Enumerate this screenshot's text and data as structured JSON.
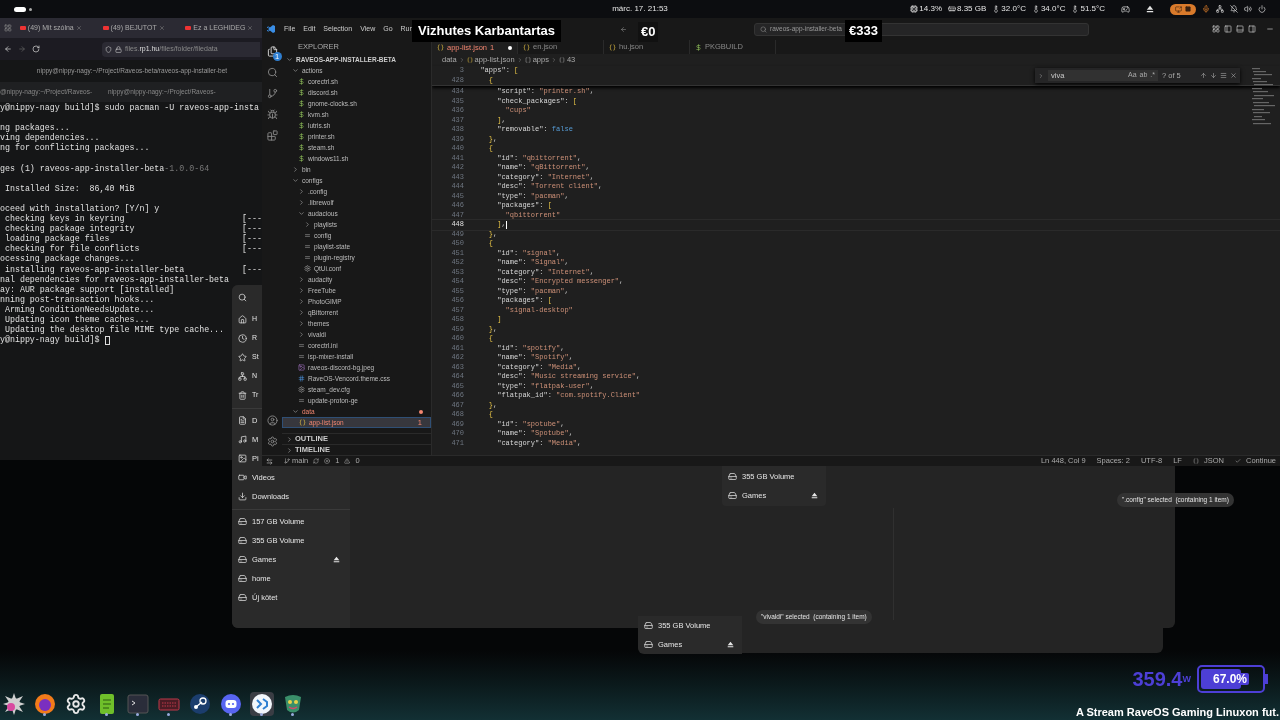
{
  "top_bar": {
    "date_time": "márc. 17. 21:53",
    "stats": [
      {
        "kind": "cpu",
        "text": "14.3%"
      },
      {
        "kind": "memory",
        "text": "8.35 GB"
      },
      {
        "kind": "temp",
        "text": "32.0°C"
      },
      {
        "kind": "temp",
        "text": "34.0°C"
      },
      {
        "kind": "temp",
        "text": "51.5°C"
      }
    ]
  },
  "browser": {
    "tabs": [
      "(49) Mit szólna",
      "(49) BEJUTOT",
      "Ez a LEGHIDEG"
    ],
    "url": "files.**rp1.hu**/files/folder/filedata"
  },
  "terminal": {
    "title": "nippy@nippy-nagy:~/Project/Raveos-beta/raveos-app-installer-bet",
    "tabs": [
      "@nippy-nagy:~/Project/Raveos-",
      "nippy@nippy-nagy:~/Project/Raveos-"
    ],
    "cursor": true,
    "lines": [
      {
        "kind": "text",
        "text": "y@nippy-nagy build]$ sudo pacman -U raveos-app-insta"
      },
      {
        "kind": "blank"
      },
      {
        "kind": "text",
        "text": "ng packages..."
      },
      {
        "kind": "text",
        "text": "ving dependencies..."
      },
      {
        "kind": "text",
        "text": "ng for conflicting packages..."
      },
      {
        "kind": "blank"
      },
      {
        "kind": "text",
        "text": "ges (1) raveos-app-installer-beta",
        "suffix": "-1.0.0-64"
      },
      {
        "kind": "blank"
      },
      {
        "kind": "text",
        "text": " Installed Size:  86,40 MiB"
      },
      {
        "kind": "blank"
      },
      {
        "kind": "text",
        "text": "oceed with installation? [Y/n] y"
      },
      {
        "kind": "text",
        "text": " checking keys in keyring",
        "progress": "[---"
      },
      {
        "kind": "text",
        "text": " checking package integrity",
        "progress": "[---"
      },
      {
        "kind": "text",
        "text": " loading package files",
        "progress": "[---"
      },
      {
        "kind": "text",
        "text": " checking for file conflicts",
        "progress": "[---"
      },
      {
        "kind": "text",
        "text": "ocessing package changes..."
      },
      {
        "kind": "text",
        "text": " installing raveos-app-installer-beta",
        "progress": "[---"
      },
      {
        "kind": "text",
        "text": "nal dependencies for raveos-app-installer-beta"
      },
      {
        "kind": "text",
        "text": "ay: AUR package support [installed]"
      },
      {
        "kind": "text",
        "text": "nning post-transaction hooks..."
      },
      {
        "kind": "text",
        "text": " Arming ConditionNeedsUpdate..."
      },
      {
        "kind": "text",
        "text": " Updating icon theme caches..."
      },
      {
        "kind": "text",
        "text": " Updating the desktop file MIME type cache..."
      },
      {
        "kind": "text",
        "text": "y@nippy-nagy build]$ "
      }
    ]
  },
  "file_manager": {
    "places": [
      {
        "label": "H",
        "kind": "home"
      },
      {
        "label": "R",
        "kind": "recent"
      },
      {
        "label": "St",
        "kind": "starred"
      },
      {
        "label": "N",
        "kind": "network"
      },
      {
        "label": "Tr",
        "kind": "trash"
      }
    ],
    "folders": [
      {
        "label": "D",
        "kind": "documents"
      },
      {
        "label": "M",
        "kind": "music"
      },
      {
        "label": "Pi",
        "kind": "pictures"
      },
      {
        "label": "Videos",
        "kind": "videos"
      },
      {
        "label": "Downloads",
        "kind": "downloads"
      }
    ],
    "volumes": [
      {
        "label": "157 GB Volume",
        "eject": false
      },
      {
        "label": "355 GB Volume",
        "eject": false
      },
      {
        "label": "Games",
        "eject": true
      },
      {
        "label": "home",
        "eject": false
      },
      {
        "label": "Új kötet",
        "eject": false
      }
    ],
    "popups": [
      {
        "items": [
          {
            "label": "355 GB Volume",
            "eject": false
          },
          {
            "label": "Games",
            "eject": true
          }
        ]
      },
      {
        "items": [
          {
            "label": "355 GB Volume",
            "eject": false
          },
          {
            "label": "Games",
            "eject": true
          }
        ]
      }
    ],
    "toasts": [
      "\".config\" selected  (containing 1 item)",
      "\"vivaldi\" selected  (containing 1 item)"
    ]
  },
  "editor": {
    "menu": [
      "File",
      "Edit",
      "Selection",
      "View",
      "Go",
      "Run"
    ],
    "search": "raveos-app-installer-beta",
    "explorer_badge": "1",
    "explorer": {
      "title": "EXPLORER",
      "tree": {
        "label": "RAVEOS-APP-INSTALLER-BETA",
        "kind": "folder",
        "expanded": true,
        "selected": false,
        "error": false,
        "children": [
          {
            "label": "actions",
            "kind": "folder",
            "expanded": true,
            "selected": false,
            "error": false,
            "children": [
              {
                "label": "corectrl.sh",
                "kind": "sh",
                "selected": false,
                "error": false
              },
              {
                "label": "discord.sh",
                "kind": "sh",
                "selected": false,
                "error": false
              },
              {
                "label": "gnome-clocks.sh",
                "kind": "sh",
                "selected": false,
                "error": false
              },
              {
                "label": "kvm.sh",
                "kind": "sh",
                "selected": false,
                "error": false
              },
              {
                "label": "lutris.sh",
                "kind": "sh",
                "selected": false,
                "error": false
              },
              {
                "label": "printer.sh",
                "kind": "sh",
                "selected": false,
                "error": false
              },
              {
                "label": "steam.sh",
                "kind": "sh",
                "selected": false,
                "error": false
              },
              {
                "label": "windows11.sh",
                "kind": "sh",
                "selected": false,
                "error": false
              }
            ]
          },
          {
            "label": "bin",
            "kind": "folder",
            "expanded": false,
            "selected": false,
            "error": false
          },
          {
            "label": "configs",
            "kind": "folder",
            "expanded": true,
            "selected": false,
            "error": false,
            "children": [
              {
                "label": ".config",
                "kind": "folder",
                "expanded": false,
                "selected": false,
                "error": false
              },
              {
                "label": ".librewolf",
                "kind": "folder",
                "expanded": false,
                "selected": false,
                "error": false
              },
              {
                "label": "audacious",
                "kind": "folder",
                "expanded": true,
                "selected": false,
                "error": false,
                "children": [
                  {
                    "label": "playlists",
                    "kind": "folder",
                    "expanded": false,
                    "selected": false,
                    "error": false
                  },
                  {
                    "label": "config",
                    "kind": "text",
                    "selected": false,
                    "error": false
                  },
                  {
                    "label": "playlist-state",
                    "kind": "text",
                    "selected": false,
                    "error": false
                  },
                  {
                    "label": "plugin-registry",
                    "kind": "text",
                    "selected": false,
                    "error": false
                  },
                  {
                    "label": "QtUi.conf",
                    "kind": "settings",
                    "selected": false,
                    "error": false
                  }
                ]
              },
              {
                "label": "audacity",
                "kind": "folder",
                "expanded": false,
                "selected": false,
                "error": false
              },
              {
                "label": "FreeTube",
                "kind": "folder",
                "expanded": false,
                "selected": false,
                "error": false
              },
              {
                "label": "PhotoGIMP",
                "kind": "folder",
                "expanded": false,
                "selected": false,
                "error": false
              },
              {
                "label": "qBittorrent",
                "kind": "folder",
                "expanded": false,
                "selected": false,
                "error": false
              },
              {
                "label": "themes",
                "kind": "folder",
                "expanded": false,
                "selected": false,
                "error": false
              },
              {
                "label": "vivaldi",
                "kind": "folder",
                "expanded": false,
                "selected": false,
                "error": false
              },
              {
                "label": "corectrl.ini",
                "kind": "text",
                "selected": false,
                "error": false
              },
              {
                "label": "isp-mixer-install",
                "kind": "text",
                "selected": false,
                "error": false
              },
              {
                "label": "raveos-discord-bg.jpeg",
                "kind": "image",
                "selected": false,
                "error": false
              },
              {
                "label": "RaveOS-Vencord.theme.css",
                "kind": "css",
                "selected": false,
                "error": false
              },
              {
                "label": "steam_dev.cfg",
                "kind": "settings",
                "selected": false,
                "error": false
              },
              {
                "label": "update-proton-ge",
                "kind": "text",
                "selected": false,
                "error": false
              }
            ]
          },
          {
            "label": "data",
            "kind": "folder",
            "expanded": true,
            "selected": false,
            "error": true,
            "children": [
              {
                "label": "app-list.json",
                "kind": "json",
                "selected": true,
                "error": true,
                "problems": "1"
              }
            ]
          }
        ]
      },
      "sections": [
        {
          "label": "OUTLINE",
          "expanded": false
        },
        {
          "label": "TIMELINE",
          "expanded": false
        }
      ]
    },
    "tabs": [
      {
        "label": "app-list.json",
        "kind": "json",
        "problems": "1",
        "modified": true,
        "selected": true
      },
      {
        "label": "en.json",
        "kind": "json",
        "modified": false,
        "selected": false
      },
      {
        "label": "hu.json",
        "kind": "json",
        "modified": false,
        "selected": false
      },
      {
        "label": "PKGBUILD",
        "kind": "sh",
        "modified": false,
        "selected": false
      }
    ],
    "breadcrumb": [
      {
        "kind": "folder",
        "text": "data"
      },
      {
        "kind": "json",
        "text": "app-list.json"
      },
      {
        "kind": "array",
        "text": "apps"
      },
      {
        "kind": "object",
        "text": "43"
      }
    ],
    "sticky": [
      {
        "number": "3",
        "text": "  \"apps\": ["
      },
      {
        "number": "428",
        "text": "    {"
      }
    ],
    "lines": [
      {
        "number": "434",
        "text": "      \"script\": \"printer.sh\",",
        "current": false
      },
      {
        "number": "435",
        "text": "      \"check_packages\": [",
        "current": false
      },
      {
        "number": "436",
        "text": "        \"cups\"",
        "current": false
      },
      {
        "number": "437",
        "text": "      ],",
        "current": false
      },
      {
        "number": "438",
        "text": "      \"removable\": false",
        "current": false
      },
      {
        "number": "439",
        "text": "    },",
        "current": false
      },
      {
        "number": "440",
        "text": "    {",
        "current": false
      },
      {
        "number": "441",
        "text": "      \"id\": \"qbittorrent\",",
        "current": false
      },
      {
        "number": "442",
        "text": "      \"name\": \"qBittorrent\",",
        "current": false
      },
      {
        "number": "443",
        "text": "      \"category\": \"Internet\",",
        "current": false
      },
      {
        "number": "444",
        "text": "      \"desc\": \"Torrent client\",",
        "current": false
      },
      {
        "number": "445",
        "text": "      \"type\": \"pacman\",",
        "current": false
      },
      {
        "number": "446",
        "text": "      \"packages\": [",
        "current": false
      },
      {
        "number": "447",
        "text": "        \"qbittorrent\"",
        "current": false
      },
      {
        "number": "448",
        "text": "      ],",
        "current": true
      },
      {
        "number": "449",
        "text": "    },",
        "current": false
      },
      {
        "number": "450",
        "text": "    {",
        "current": false
      },
      {
        "number": "451",
        "text": "      \"id\": \"signal\",",
        "current": false
      },
      {
        "number": "452",
        "text": "      \"name\": \"Signal\",",
        "current": false
      },
      {
        "number": "453",
        "text": "      \"category\": \"Internet\",",
        "current": false
      },
      {
        "number": "454",
        "text": "      \"desc\": \"Encrypted messenger\",",
        "current": false
      },
      {
        "number": "455",
        "text": "      \"type\": \"pacman\",",
        "current": false
      },
      {
        "number": "456",
        "text": "      \"packages\": [",
        "current": false
      },
      {
        "number": "457",
        "text": "        \"signal-desktop\"",
        "current": false
      },
      {
        "number": "458",
        "text": "      ]",
        "current": false
      },
      {
        "number": "459",
        "text": "    },",
        "current": false
      },
      {
        "number": "460",
        "text": "    {",
        "current": false
      },
      {
        "number": "461",
        "text": "      \"id\": \"spotify\",",
        "current": false
      },
      {
        "number": "462",
        "text": "      \"name\": \"Spotify\",",
        "current": false
      },
      {
        "number": "463",
        "text": "      \"category\": \"Media\",",
        "current": false
      },
      {
        "number": "464",
        "text": "      \"desc\": \"Music streaming service\",",
        "current": false
      },
      {
        "number": "465",
        "text": "      \"type\": \"flatpak-user\",",
        "current": false
      },
      {
        "number": "466",
        "text": "      \"flatpak_id\": \"com.spotify.Client\"",
        "current": false
      },
      {
        "number": "467",
        "text": "    },",
        "current": false
      },
      {
        "number": "468",
        "text": "    {",
        "current": false
      },
      {
        "number": "469",
        "text": "      \"id\": \"spotube\",",
        "current": false
      },
      {
        "number": "470",
        "text": "      \"name\": \"Spotube\",",
        "current": false
      },
      {
        "number": "471",
        "text": "      \"category\": \"Media\",",
        "current": false
      }
    ],
    "find": {
      "value": "viva",
      "options": [
        "Aa",
        "ab",
        ".*"
      ],
      "result": "? of 5"
    },
    "status": {
      "branch": "main",
      "errors": "1",
      "warnings": "0",
      "items": [
        "Ln 448, Col 9",
        "Spaces: 2",
        "UTF-8",
        "LF"
      ],
      "language": "JSON",
      "action": "Continue"
    }
  },
  "stream_overlay": {
    "title": "Vizhutes Karbantartas",
    "amount_1": "€0",
    "amount_2": "€333",
    "power": "359.4",
    "power_unit": "W",
    "battery": {
      "level": 0.67,
      "label": "67.0%"
    },
    "caption": "A Stream RaveOS Gaming Linuxon fut."
  },
  "dock": [
    {
      "kind": "spiky",
      "running": false,
      "selected": false
    },
    {
      "kind": "browser",
      "running": true,
      "selected": false
    },
    {
      "kind": "settings",
      "running": false,
      "selected": false
    },
    {
      "kind": "notes",
      "running": true,
      "selected": false
    },
    {
      "kind": "terminal",
      "running": true,
      "selected": false
    },
    {
      "kind": "keyboard",
      "running": true,
      "selected": false
    },
    {
      "kind": "launcher",
      "running": false,
      "selected": false
    },
    {
      "kind": "chat",
      "running": true,
      "selected": false
    },
    {
      "kind": "code",
      "running": true,
      "selected": true
    },
    {
      "kind": "mask",
      "running": true,
      "selected": false
    }
  ]
}
